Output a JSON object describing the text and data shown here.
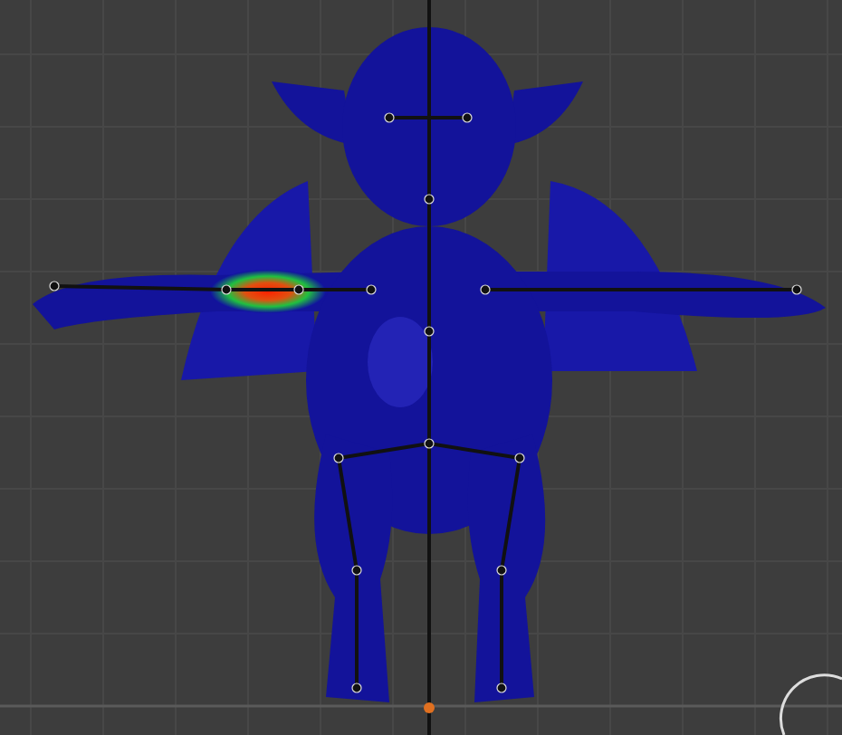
{
  "viewport": {
    "show_grid": true,
    "show_armature": true,
    "show_weight_highlight": true
  }
}
